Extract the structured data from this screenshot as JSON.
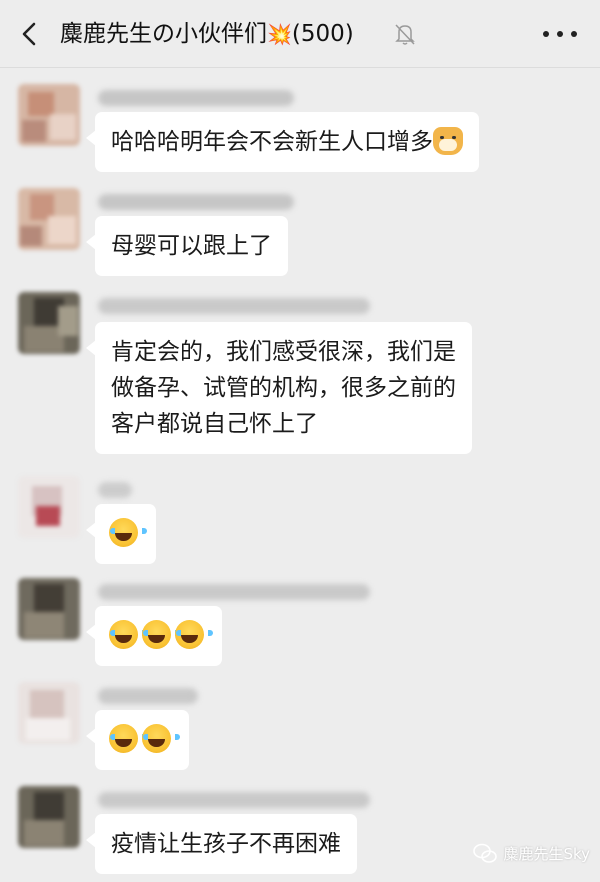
{
  "header": {
    "title": "麋鹿先生の小伙伴们",
    "title_emoji": "💥",
    "member_count": "(500)",
    "back_icon": "chevron-left-icon",
    "mute_icon": "bell-muted-icon",
    "more_icon": "more-dots-icon"
  },
  "messages": [
    {
      "text": "哈哈哈明年会不会新生人口增多",
      "suffix_emoji": "doge-icon"
    },
    {
      "text": "母婴可以跟上了"
    },
    {
      "lines": [
        "肯定会的，我们感受很深，我们是",
        "做备孕、试管的机构，很多之前的",
        "客户都说自己怀上了"
      ]
    },
    {
      "emoji_count": 1,
      "emoji": "laugh-cry-icon"
    },
    {
      "emoji_count": 3,
      "emoji": "laugh-cry-icon"
    },
    {
      "emoji_count": 2,
      "emoji": "laugh-cry-icon"
    },
    {
      "text": "疫情让生孩子不再困难"
    }
  ],
  "watermark": {
    "text": "麋鹿先生Sky",
    "icon": "wechat-icon"
  },
  "colors": {
    "background": "#ededed",
    "bubble": "#ffffff",
    "text": "#1b1b1b"
  }
}
